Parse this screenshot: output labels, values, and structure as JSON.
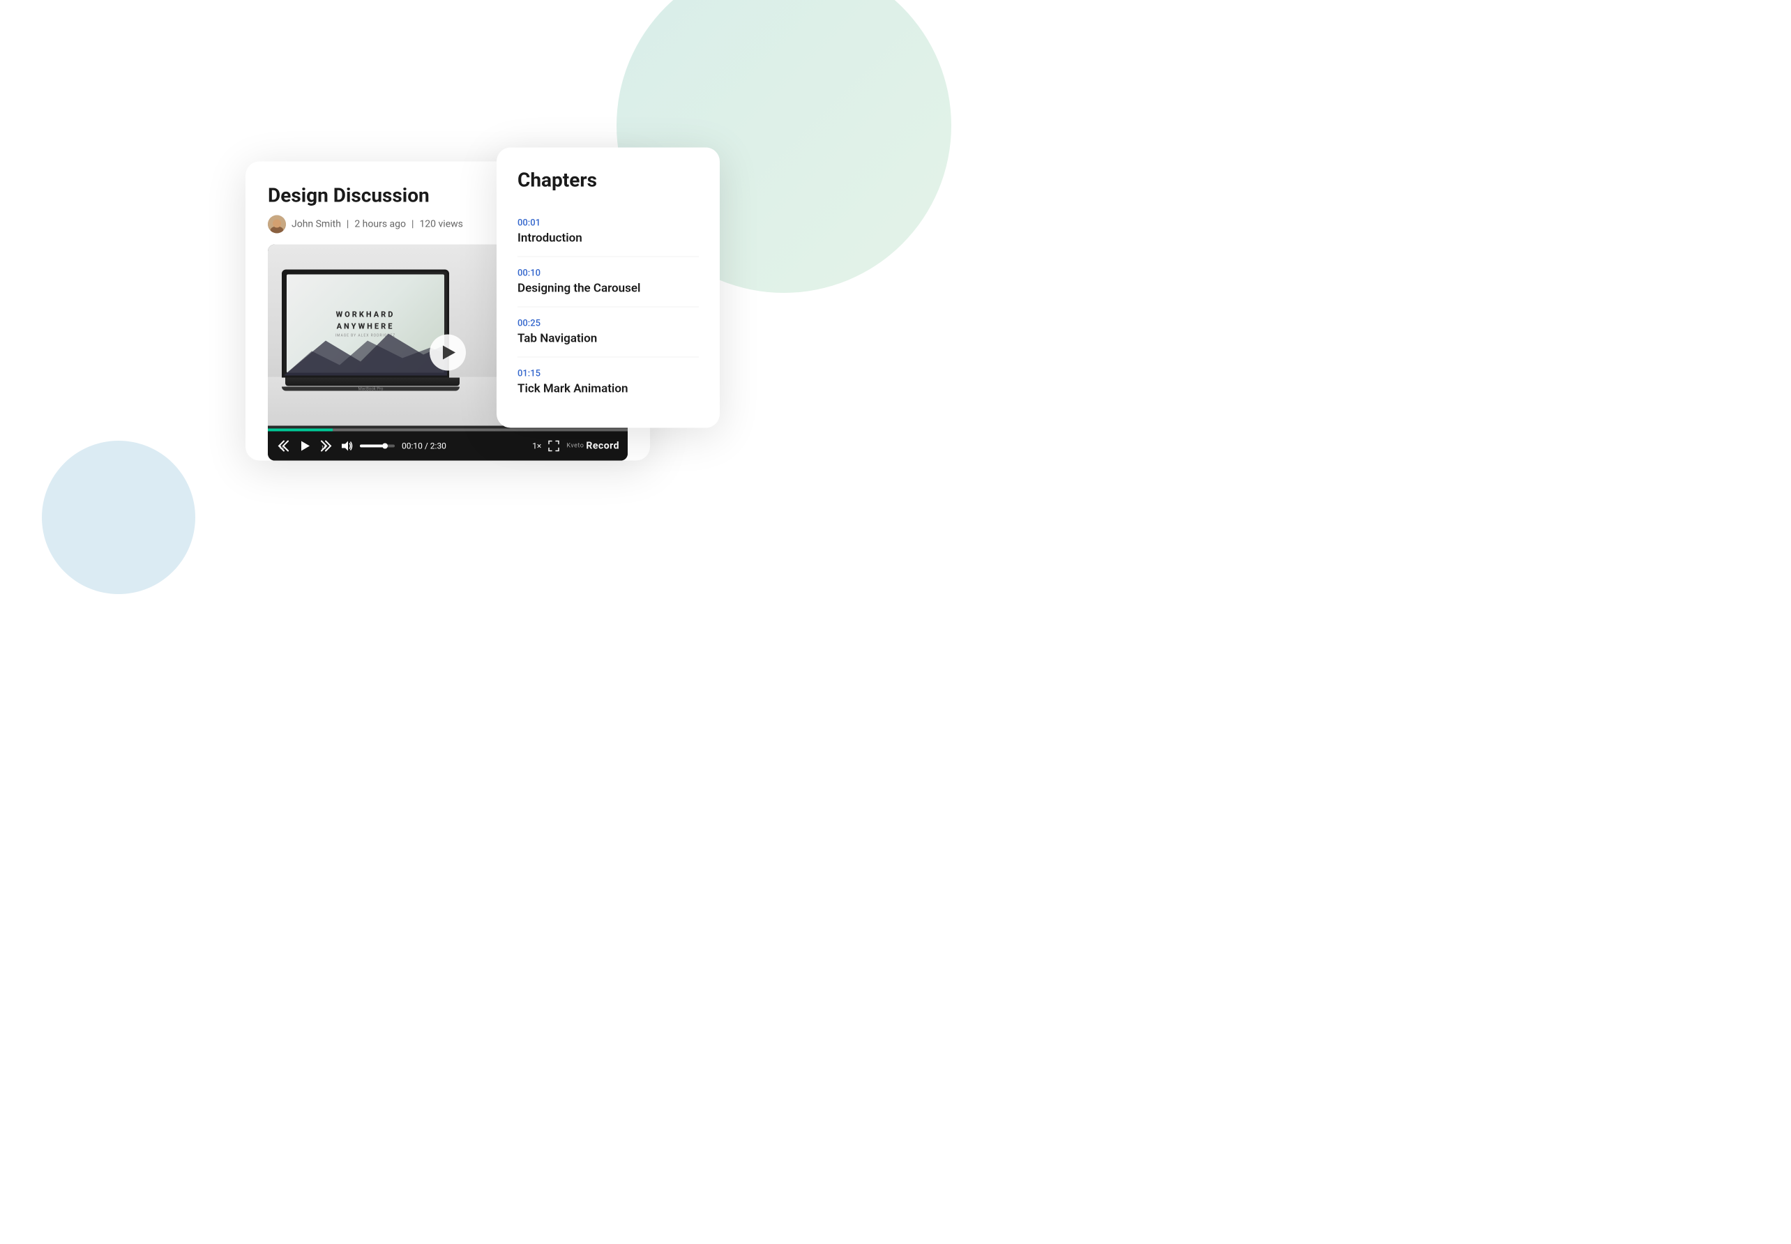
{
  "page": {
    "background": "#ffffff"
  },
  "video_card": {
    "title": "Design Discussion",
    "author": "John Smith",
    "time_ago": "2 hours ago",
    "views": "120 views",
    "meta_separator": "|"
  },
  "player": {
    "progress_percent": 18,
    "current_time": "00:10",
    "total_time": "2:30",
    "time_display": "00:10 / 2:30",
    "speed": "1×",
    "volume_percent": 65,
    "play_label": "Play",
    "rewind_label": "Rewind 10s",
    "forward_label": "Forward 10s",
    "fullscreen_label": "Fullscreen",
    "record_label": "Record",
    "brand_label": "Kveto"
  },
  "scene": {
    "laptop_brand": "MacBook Pro",
    "screen_text_line1": "WORKHARD",
    "screen_text_line2": "ANYWHERE",
    "screen_subtext": "IMAGE BY ALEX RODRIGUEZ"
  },
  "chapters": {
    "title": "Chapters",
    "items": [
      {
        "time": "00:01",
        "name": "Introduction"
      },
      {
        "time": "00:10",
        "name": "Designing the Carousel"
      },
      {
        "time": "00:25",
        "name": "Tab Navigation"
      },
      {
        "time": "01:15",
        "name": "Tick Mark Animation"
      }
    ]
  }
}
